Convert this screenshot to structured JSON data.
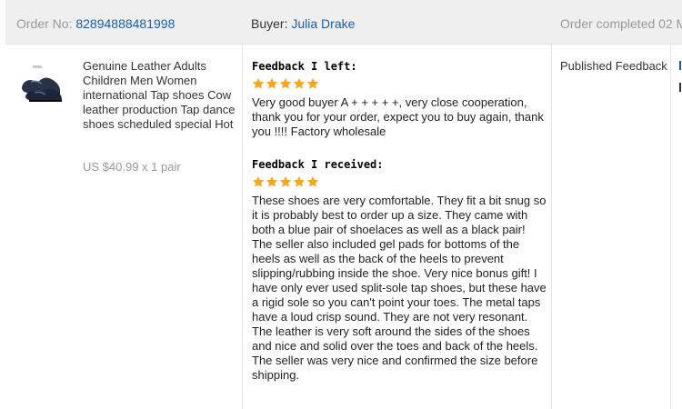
{
  "header": {
    "order_label": "Order No: ",
    "order_number": "82894888481998",
    "buyer_label": "Buyer: ",
    "buyer_name": "Julia Drake",
    "status_prefix": "Order completed 02 M"
  },
  "product": {
    "title": "Genuine Leather Adults Children Men Women international Tap shoes Cow leather production Tap dance shoes scheduled special Hot",
    "price": "US $40.99 x 1 pair",
    "image_icon": "tap-shoe-icon"
  },
  "feedback_left": {
    "heading": "Feedback I left:",
    "rating": 5,
    "text": "Very good buyer A + + + + +, very close cooperation, thank you for your order, expect you to buy again, thank you !!!! Factory wholesale"
  },
  "feedback_received": {
    "heading": "Feedback I received:",
    "rating": 5,
    "text": "These shoes are very comfortable. They fit a bit snug so it is probably best to order up a size. They came with both a blue pair of shoelaces as well as a black pair! The seller also included gel pads for bottoms of the heels as well as the back of the heels to prevent slipping/rubbing inside the shoe. Very nice bonus gift! I have only ever used split-sole tap shoes, but these have a rigid sole so you can't point your toes. The metal taps have a loud crisp sound. They are not very resonant. The leather is very soft around the sides of the shoes and nice and solid over the toes and back of the heels. The seller was very nice and confirmed the size before shipping."
  },
  "status": {
    "text": "Published Feedback"
  },
  "colors": {
    "star": "#f5a623",
    "link": "#1f5fa8",
    "header_bg": "#efefef"
  }
}
